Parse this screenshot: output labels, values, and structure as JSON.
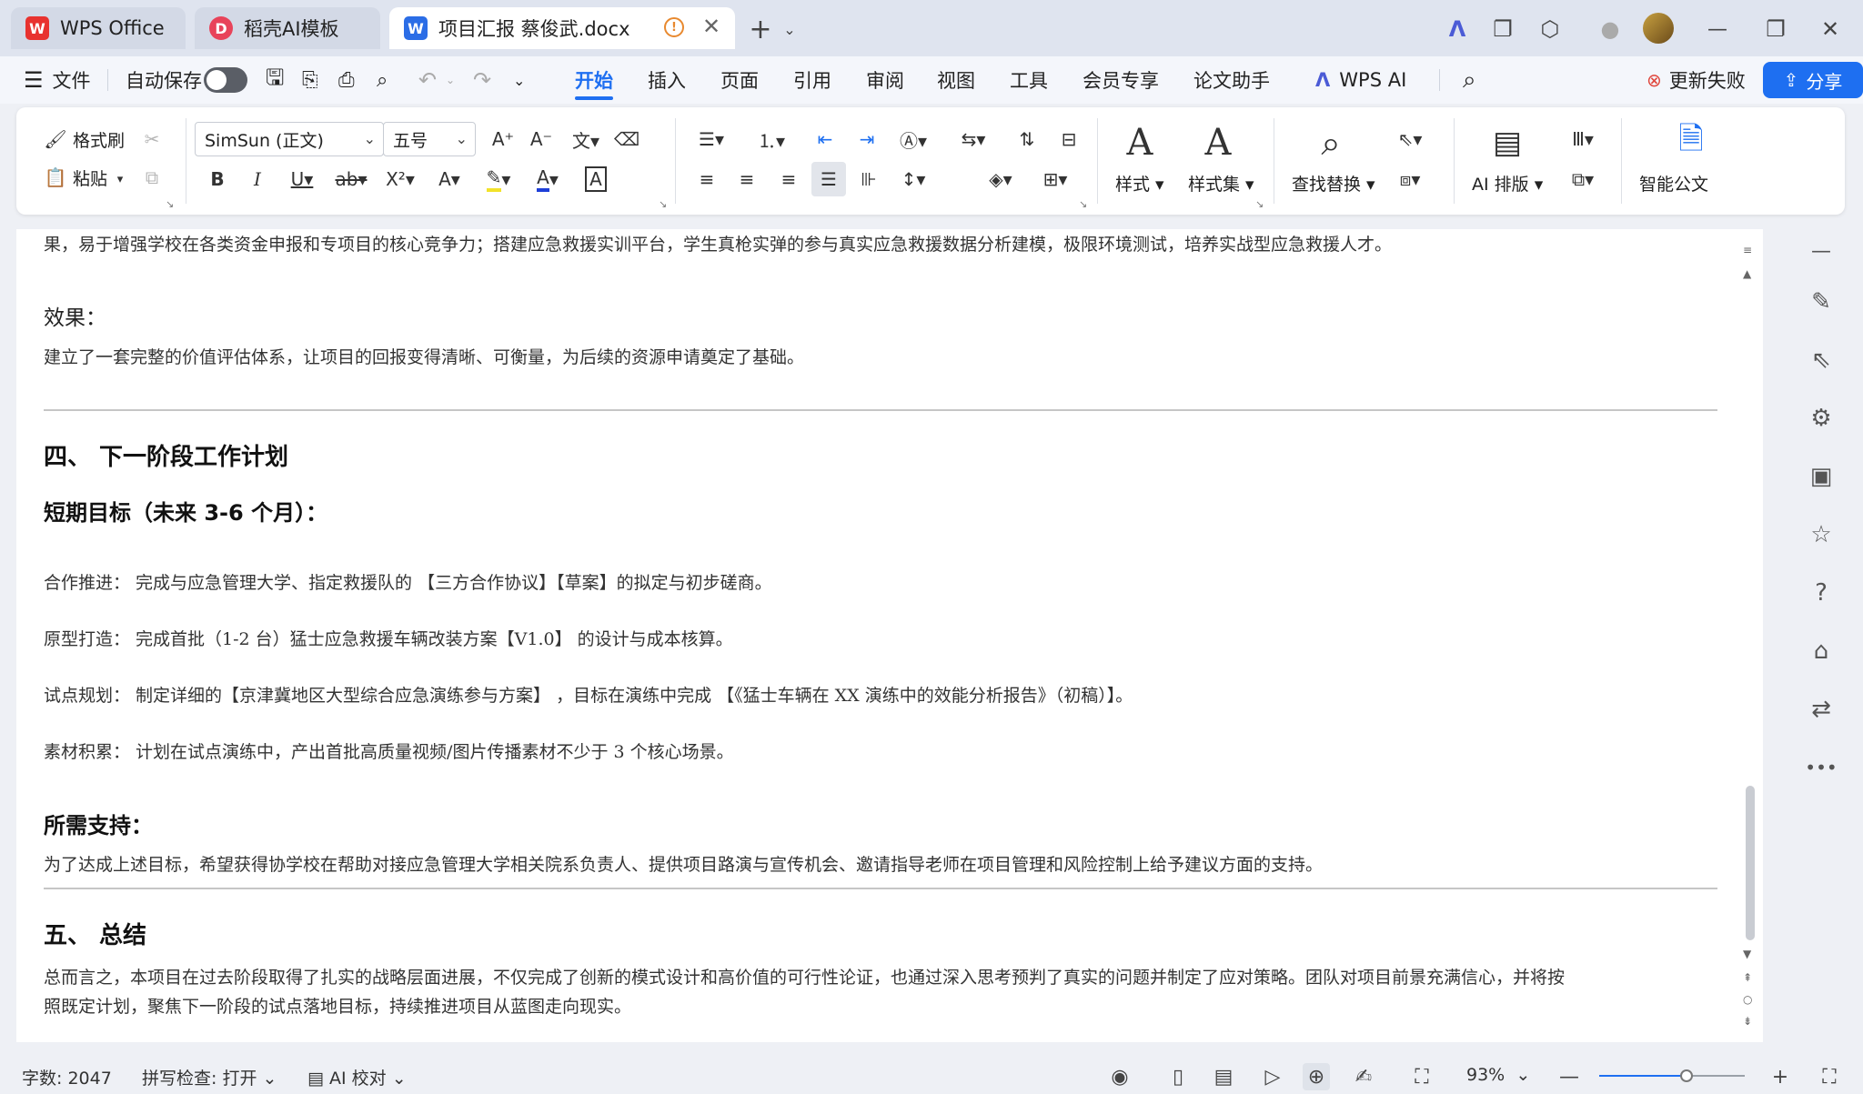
{
  "tabs": [
    {
      "label": "WPS Office",
      "logo": "W"
    },
    {
      "label": "稻壳AI模板",
      "logo": "D"
    },
    {
      "label": "项目汇报 蔡俊武.docx",
      "logo": "W"
    }
  ],
  "menu": {
    "file": "文件",
    "autosave": "自动保存",
    "tabs": [
      "开始",
      "插入",
      "页面",
      "引用",
      "审阅",
      "视图",
      "工具",
      "会员专享",
      "论文助手",
      "WPS AI"
    ],
    "active_tab": "开始",
    "update_failed": "更新失败",
    "share": "分享"
  },
  "ribbon": {
    "format_painter": "格式刷",
    "paste": "粘贴",
    "font_name": "SimSun (正文)",
    "font_size": "五号",
    "styles": "样式",
    "style_set": "样式集",
    "find_replace": "查找替换",
    "ai_layout": "AI 排版",
    "smart_doc": "智能公文"
  },
  "document": {
    "line_top": "果，易于增强学校在各类资金申报和专项目的核心竞争力；搭建应急救援实训平台，学生真枪实弹的参与真实应急救援数据分析建模，极限环境测试，培养实战型应急救援人才。",
    "effect_heading": "效果：",
    "effect_text": "建立了一套完整的价值评估体系，让项目的回报变得清晰、可衡量，为后续的资源申请奠定了基础。",
    "section4_title": "四、  下一阶段工作计划",
    "short_term_title": "短期目标（未来 3-6 个月）：",
    "items": [
      "合作推进：  完成与应急管理大学、指定救援队的 【三方合作协议】【草案】的拟定与初步磋商。",
      "原型打造：  完成首批（1-2 台）猛士应急救援车辆改装方案【V1.0】 的设计与成本核算。",
      "试点规划：  制定详细的【京津冀地区大型综合应急演练参与方案】 ，目标在演练中完成 【《猛士车辆在 XX 演练中的效能分析报告》（初稿）】。",
      "素材积累：  计划在试点演练中，产出首批高质量视频/图片传播素材不少于 3 个核心场景。"
    ],
    "support_title": "所需支持：",
    "support_text": "为了达成上述目标，希望获得协学校在帮助对接应急管理大学相关院系负责人、提供项目路演与宣传机会、邀请指导老师在项目管理和风险控制上给予建议方面的支持。",
    "section5_title": "五、  总结",
    "summary_line1": "总而言之，本项目在过去阶段取得了扎实的战略层面进展，不仅完成了创新的模式设计和高价值的可行性论证，也通过深入思考预判了真实的问题并制定了应对策略。团队对项目前景充满信心，并将按",
    "summary_line2": "照既定计划，聚焦下一阶段的试点落地目标，持续推进项目从蓝图走向现实。"
  },
  "status": {
    "word_count": "字数: 2047",
    "spell_check": "拼写检查: 打开",
    "ai_proofread": "AI 校对",
    "zoom": "93%",
    "zoom_level": 0.6
  },
  "colors": {
    "accent": "#1e6ff1",
    "wps_red": "#e8322f",
    "docer_red": "#e8435a",
    "doc_blue": "#2b6de6"
  }
}
